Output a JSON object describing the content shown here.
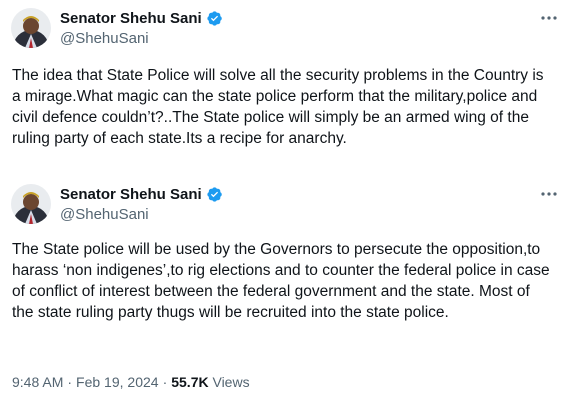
{
  "tweets": [
    {
      "author": {
        "name": "Senator Shehu Sani",
        "handle": "@ShehuSani",
        "verified": true
      },
      "more_icon": "more-horizontal-icon",
      "text": "The idea that State Police will solve all the security problems in the Country is a mirage.What magic can the state police perform that the military,police and civil defence couldn’t?..The State police will simply be an armed wing of the ruling party of each state.Its a recipe for anarchy."
    },
    {
      "author": {
        "name": "Senator Shehu Sani",
        "handle": "@ShehuSani",
        "verified": true
      },
      "more_icon": "more-horizontal-icon",
      "text": "The State police will be used by the Governors to persecute the opposition,to harass ‘non indigenes’,to rig elections and to counter the federal police in case of conflict of interest between the federal government and the state. Most of the state ruling party thugs will be recruited into the state police.",
      "meta": {
        "time": "9:48 AM",
        "date": "Feb 19, 2024",
        "views_count": "55.7K",
        "views_label": "Views",
        "separator": "·"
      }
    }
  ],
  "colors": {
    "text": "#0f1419",
    "secondary": "#536471",
    "verified_blue": "#1d9bf0",
    "background": "#ffffff"
  }
}
